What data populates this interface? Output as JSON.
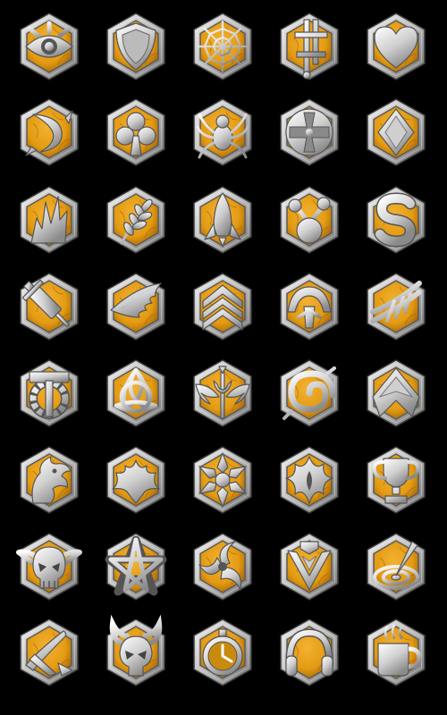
{
  "sheet": {
    "background": "#000000",
    "columns": 5,
    "rows": 8,
    "colors": {
      "frame_light": "#eeeeee",
      "frame_mid": "#b9b9b9",
      "frame_dark": "#6e6e6e",
      "frame_edge": "#3a3a3a",
      "gold_light": "#f3b233",
      "gold_mid": "#e39b12",
      "gold_dark": "#9a5a05",
      "emblem_light": "#ffffff",
      "emblem_mid": "#cfcfcf",
      "emblem_dark": "#8a8a8a"
    }
  },
  "icons": [
    {
      "name": "eye-icon"
    },
    {
      "name": "shield-icon"
    },
    {
      "name": "spider-web-icon"
    },
    {
      "name": "double-sword-icon"
    },
    {
      "name": "heart-icon"
    },
    {
      "name": "blade-swirl-icon"
    },
    {
      "name": "club-icon"
    },
    {
      "name": "spider-icon"
    },
    {
      "name": "iron-cross-icon"
    },
    {
      "name": "diamond-icon"
    },
    {
      "name": "explosion-icon"
    },
    {
      "name": "wheat-icon"
    },
    {
      "name": "rocket-icon"
    },
    {
      "name": "molecule-icon"
    },
    {
      "name": "dollar-icon"
    },
    {
      "name": "syringe-icon"
    },
    {
      "name": "wing-icon"
    },
    {
      "name": "chevron-stack-icon"
    },
    {
      "name": "helmet-icon"
    },
    {
      "name": "barbed-wire-icon"
    },
    {
      "name": "hammer-gear-icon"
    },
    {
      "name": "triquetra-icon"
    },
    {
      "name": "winged-trident-icon"
    },
    {
      "name": "spiral-icon"
    },
    {
      "name": "arrowhead-icon"
    },
    {
      "name": "dragon-head-icon"
    },
    {
      "name": "tribal-bat-icon"
    },
    {
      "name": "snowflake-icon"
    },
    {
      "name": "tribal-emblem-icon"
    },
    {
      "name": "trophy-icon"
    },
    {
      "name": "demon-skull-icon"
    },
    {
      "name": "pentagram-icon"
    },
    {
      "name": "triskelion-icon"
    },
    {
      "name": "lightning-sword-icon"
    },
    {
      "name": "target-icon"
    },
    {
      "name": "broken-blade-icon"
    },
    {
      "name": "horned-skull-icon"
    },
    {
      "name": "stopwatch-icon"
    },
    {
      "name": "headphones-icon"
    },
    {
      "name": "coffee-mug-icon"
    }
  ]
}
